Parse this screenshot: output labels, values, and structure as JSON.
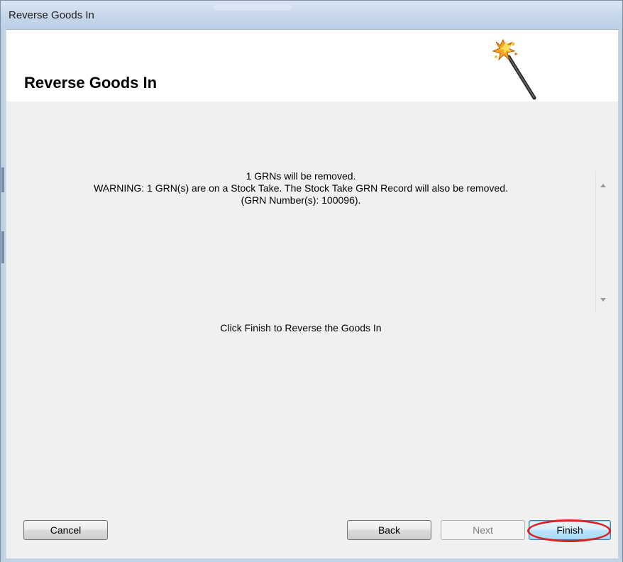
{
  "window": {
    "title": "Reverse Goods In"
  },
  "header": {
    "heading": "Reverse Goods In",
    "icon": "magic-wand-icon"
  },
  "messages": {
    "line1": "1 GRNs will be removed.",
    "line2": "WARNING: 1 GRN(s) are on a Stock Take. The Stock Take GRN Record will also be removed.",
    "line3": "(GRN Number(s): 100096).",
    "instruction": "Click Finish to Reverse the Goods In"
  },
  "buttons": {
    "cancel": "Cancel",
    "back": "Back",
    "next": "Next",
    "finish": "Finish"
  },
  "colors": {
    "highlight_circle": "#e0201f"
  }
}
